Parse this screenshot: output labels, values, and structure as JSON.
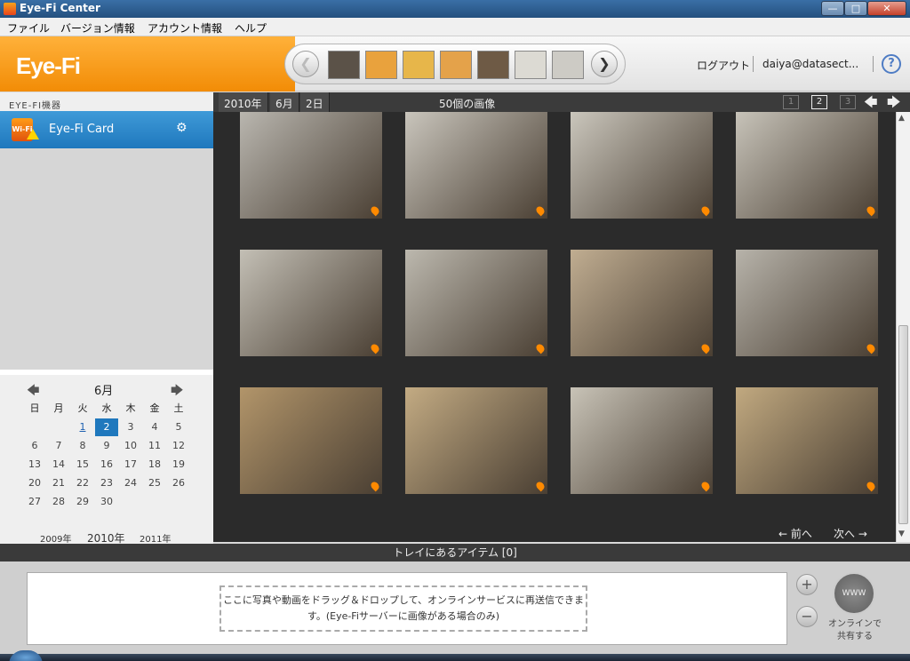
{
  "window": {
    "title": "Eye-Fi Center"
  },
  "menu": [
    "ファイル",
    "バージョン情報",
    "アカウント情報",
    "ヘルプ"
  ],
  "header": {
    "logo": "Eye-Fi",
    "logout": "ログアウト",
    "account": "daiya@datasect...",
    "help": "?"
  },
  "strip_thumbs": [
    "#5b5248",
    "#e9a23d",
    "#e7b64a",
    "#e4a24a",
    "#6e5a45",
    "#dcdad3",
    "#cdcbc5"
  ],
  "sidebar": {
    "heading": "EYE-FI機器",
    "device_name": "Eye-Fi Card",
    "device_icon_text": "Wi-Fi"
  },
  "calendar": {
    "month": "6月",
    "weekdays": [
      "日",
      "月",
      "火",
      "水",
      "木",
      "金",
      "土"
    ],
    "days": [
      [
        "",
        "",
        "1",
        "2",
        "3",
        "4",
        "5"
      ],
      [
        "6",
        "7",
        "8",
        "9",
        "10",
        "11",
        "12"
      ],
      [
        "13",
        "14",
        "15",
        "16",
        "17",
        "18",
        "19"
      ],
      [
        "20",
        "21",
        "22",
        "23",
        "24",
        "25",
        "26"
      ],
      [
        "27",
        "28",
        "29",
        "30",
        "",
        "",
        ""
      ]
    ],
    "linked_day": "1",
    "selected_day": "2",
    "years": [
      "2009年",
      "2010年",
      "2011年"
    ]
  },
  "toolbar": {
    "year": "2010年",
    "month": "6月",
    "day": "2日",
    "count": "50個の画像",
    "pages": [
      "1",
      "2",
      "3"
    ],
    "current_page": "2"
  },
  "photos": [
    [
      "#b9b6af",
      "#c9c5bc",
      "#cac6bc",
      "#c7c3b9"
    ],
    [
      "#c3bfb5",
      "#bcb8ae",
      "#c0ad91",
      "#b7b3aa"
    ],
    [
      "#b2956a",
      "#c3ab83",
      "#c8c3b7",
      "#c1a980"
    ]
  ],
  "pager": {
    "prev": "← 前へ",
    "next": "次へ →"
  },
  "tray": {
    "heading": "トレイにあるアイテム [0]",
    "drop_line1": "ここに写真や動画をドラッグ＆ドロップして、オンラインサービスに再送信できま",
    "drop_line2": "す。(Eye-Fiサーバーに画像がある場合のみ)",
    "share_label1": "オンラインで",
    "share_label2": "共有する"
  }
}
